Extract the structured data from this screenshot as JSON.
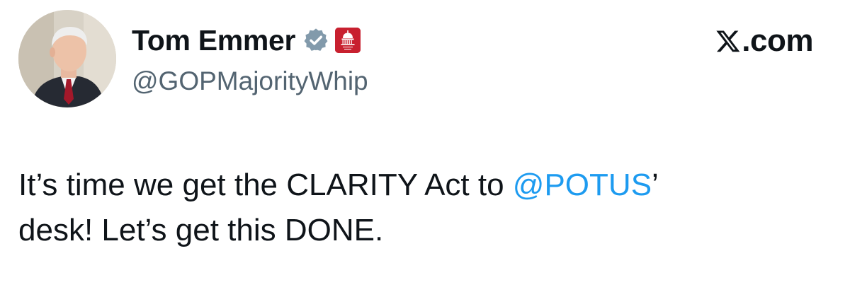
{
  "author": {
    "display_name": "Tom Emmer",
    "handle": "@GOPMajorityWhip",
    "verified": true,
    "avatar_icon": "profile-photo",
    "affiliate_icon": "capitol-dome-badge"
  },
  "brand": {
    "logo_icon": "x-logo-icon",
    "text": ".com"
  },
  "tweet": {
    "line1_before": "It’s time we get the CLARITY Act to ",
    "mention": "@POTUS",
    "line1_after": "’",
    "line2": "desk! Let’s get this DONE."
  },
  "colors": {
    "text": "#0f1419",
    "handle": "#536471",
    "mention": "#1d9bf0",
    "verified_badge": "#829aab",
    "affiliate_badge": "#c8202f"
  }
}
